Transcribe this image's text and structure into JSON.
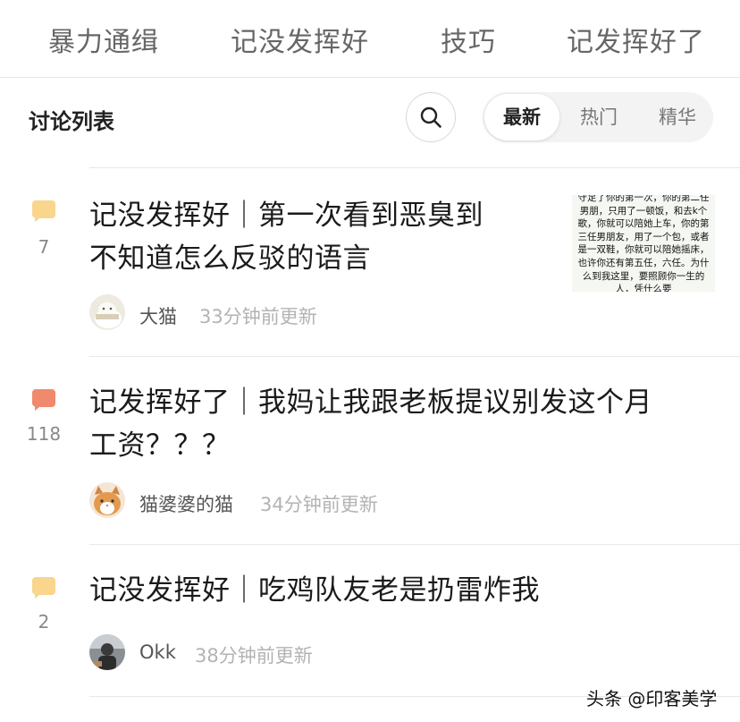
{
  "top_tabs": [
    "暴力通缉",
    "记没发挥好",
    "技巧",
    "记发挥好了"
  ],
  "header": {
    "list_title": "讨论列表",
    "sort_options": [
      "最新",
      "热门",
      "精华"
    ],
    "active_sort": "最新"
  },
  "posts": [
    {
      "count": "7",
      "bubble_color": "#f9d58e",
      "title_line1": "记没发挥好｜第一次看到恶臭到",
      "title_line2": "不知道怎么反驳的语言",
      "author": "大猫",
      "time": "33分钟前更新",
      "thumbnail_text": "守足了你的第一次，你的第二任男朋，只用了一顿饭，和去k个歌，你就可以陪她上车，你的第三任男朋友，用了一个包，或者是一双鞋，你就可以陪她摇床，也许你还有第五任，六任。为什么到我这里，要照顾你一生的人，凭什么要"
    },
    {
      "count": "118",
      "bubble_color": "#f08a6c",
      "title_line1": "记发挥好了｜我妈让我跟老板提议别发这个月",
      "title_line2": "工资？？？",
      "author": "猫婆婆的猫",
      "time": "34分钟前更新"
    },
    {
      "count": "2",
      "bubble_color": "#f9d58e",
      "title_line1": "记没发挥好｜吃鸡队友老是扔雷炸我",
      "author": "Okk",
      "time": "38分钟前更新"
    }
  ],
  "watermark": "头条 @印客美学",
  "colors": {
    "accent_hot": "#f08a6c",
    "accent_normal": "#f9d58e",
    "muted_text": "#b3b3b3"
  }
}
